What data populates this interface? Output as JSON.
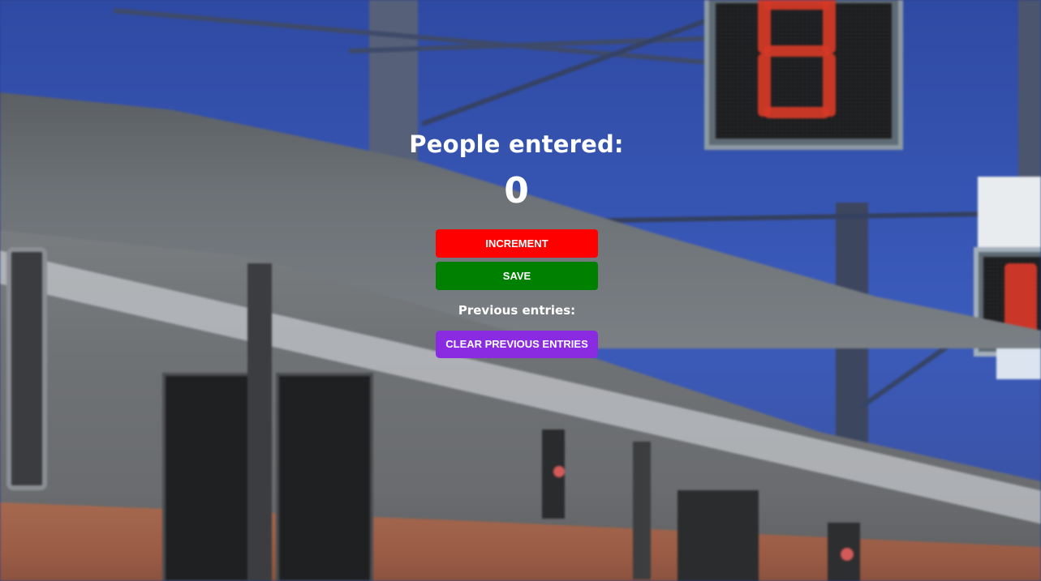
{
  "counter": {
    "title": "People entered:",
    "count": "0"
  },
  "buttons": {
    "increment_label": "INCREMENT",
    "save_label": "SAVE",
    "clear_label": "CLEAR PREVIOUS ENTRIES"
  },
  "entries": {
    "label": "Previous entries:",
    "items": []
  },
  "colors": {
    "increment": "#ff0000",
    "save": "#008000",
    "clear": "#8a2be2",
    "text": "#ffffff"
  },
  "background": {
    "description_icon": "train-photo-background"
  }
}
